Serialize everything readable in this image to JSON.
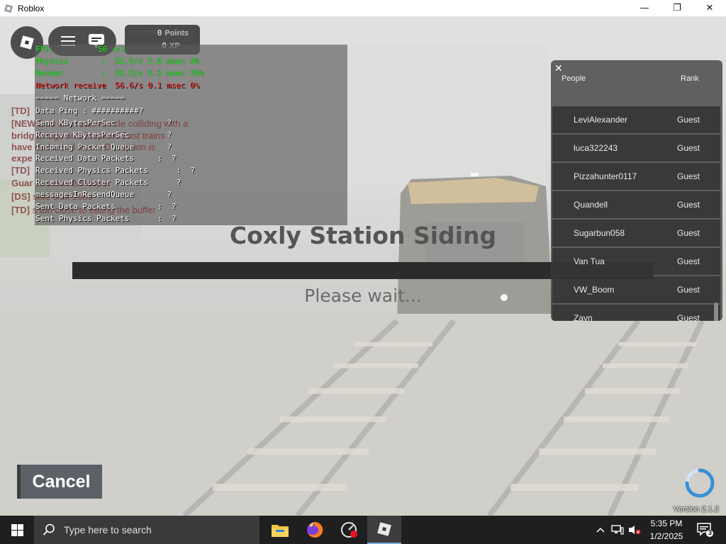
{
  "window": {
    "title": "Roblox",
    "buttons": {
      "minimize": "—",
      "maximize": "❐",
      "close": "✕"
    }
  },
  "hud": {
    "points": {
      "dim": "000000",
      "value": "0",
      "label": "Points"
    },
    "xp": {
      "dim": "0000000",
      "value": "0",
      "label": "XP"
    }
  },
  "stats": {
    "fps": {
      "label": "FPS",
      "value": "56 +/s"
    },
    "physics": {
      "label": "Physics",
      "value": ":  52.2/s 2.8 msec 4%"
    },
    "render": {
      "label": "Render",
      "value": ":  55.5/s 5.3 msec 29%"
    },
    "network_receive": {
      "label": "Network receive",
      "value": ":  56.6/s 0.1 msec 0%"
    },
    "network_header": "===== Network =====",
    "data_ping": "Data Ping : ##########?",
    "send_kbytes": "Send KBytesPerSec           ?",
    "receive_kbytes": "Receive KBytesPerSec        ?",
    "incoming_queue": "Incoming Packet Queue       ?",
    "received_data": "Received Data Packets     :  ?",
    "received_physics": "Received Physics Packets      :  ?",
    "received_cluster": "Received Cluster Packets      ?",
    "resend_queue": "messagesInResendQueue       ?",
    "sent_data": "Sent Data Packets         :  ?",
    "sent_physics": "Sent Physics Packets      :  ?"
  },
  "chat": [
    {
      "tag": "[TD]",
      "text": ""
    },
    {
      "tag": "[NEW",
      "text": "                     Due to a road vehicle colliding with a"
    },
    {
      "tag": "bridg",
      "text": "                      Bridge and Stepford East trains"
    },
    {
      "tag": "have",
      "text": "                          eed on all times. Disruption is"
    },
    {
      "tag": "expe",
      "text": ""
    },
    {
      "tag": "[TD]",
      "text": ""
    },
    {
      "tag": "Guar",
      "text": "                              re a non-full depot"
    },
    {
      "tag": "[DS]",
      "text": "                              safe shift 2089"
    },
    {
      "tag": "[TD]",
      "text": "                              s too close to eating the buffer"
    }
  ],
  "loading": {
    "station_title": "Coxly Station Siding",
    "status": "Please wait...",
    "cancel_label": "Cancel",
    "version": "Version 2.1.2"
  },
  "playerlist": {
    "header_people": "People",
    "header_rank": "Rank",
    "players": [
      {
        "name": "LeviAlexander",
        "rank": "Guest"
      },
      {
        "name": "luca322243",
        "rank": "Guest"
      },
      {
        "name": "Pizzahunter0117",
        "rank": "Guest"
      },
      {
        "name": "Quandell",
        "rank": "Guest"
      },
      {
        "name": "Sugarbun058",
        "rank": "Guest"
      },
      {
        "name": "Van Tua",
        "rank": "Guest"
      },
      {
        "name": "VW_Boom",
        "rank": "Guest"
      },
      {
        "name": "Zayn",
        "rank": "Guest"
      }
    ]
  },
  "taskbar": {
    "search_placeholder": "Type here to search",
    "time": "5:35 PM",
    "date": "1/2/2025",
    "notification_count": "3"
  },
  "colors": {
    "stats_green": "#1aff1a",
    "taskbar": "#1f1f1f",
    "progress_bar": "#2c2c2c"
  }
}
